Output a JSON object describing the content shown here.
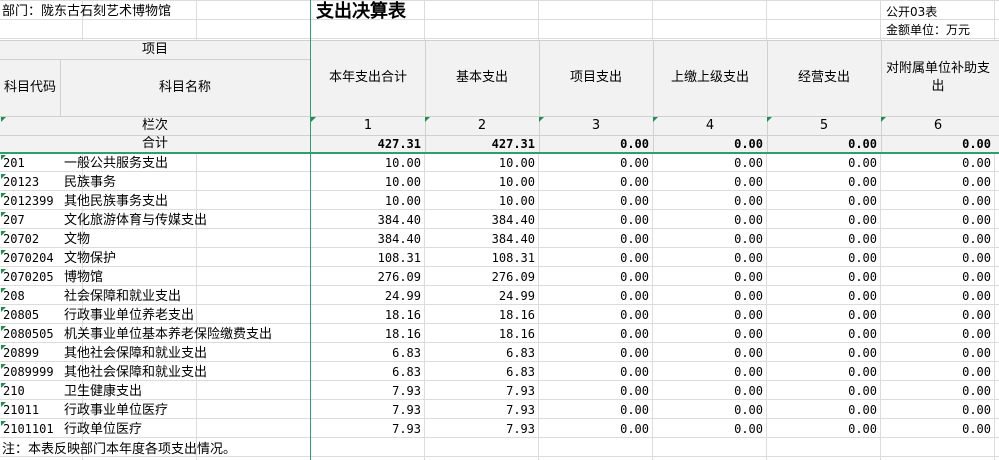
{
  "sheet": {
    "department_label": "部门：陇东古石刻艺术博物馆",
    "title": "支出决算表",
    "form_code": "公开03表",
    "unit_label": "金额单位：万元",
    "note": "注：本表反映部门本年度各项支出情况。"
  },
  "header": {
    "item_label": "项目",
    "code_label": "科目代码",
    "name_label": "科目名称",
    "col_total": "本年支出合计",
    "col_basic": "基本支出",
    "col_project": "项目支出",
    "col_upper": "上缴上级支出",
    "col_business": "经营支出",
    "col_subsidy": "对附属单位补助支出",
    "seq_label": "栏次",
    "seq": [
      "1",
      "2",
      "3",
      "4",
      "5",
      "6"
    ]
  },
  "total_row": {
    "label": "合计",
    "values": [
      "427.31",
      "427.31",
      "0.00",
      "0.00",
      "0.00",
      "0.00"
    ]
  },
  "rows": [
    {
      "code": "201",
      "name": "一般公共服务支出",
      "values": [
        "10.00",
        "10.00",
        "0.00",
        "0.00",
        "0.00",
        "0.00"
      ]
    },
    {
      "code": "20123",
      "name": "民族事务",
      "values": [
        "10.00",
        "10.00",
        "0.00",
        "0.00",
        "0.00",
        "0.00"
      ]
    },
    {
      "code": "2012399",
      "name": "其他民族事务支出",
      "values": [
        "10.00",
        "10.00",
        "0.00",
        "0.00",
        "0.00",
        "0.00"
      ]
    },
    {
      "code": "207",
      "name": "文化旅游体育与传媒支出",
      "values": [
        "384.40",
        "384.40",
        "0.00",
        "0.00",
        "0.00",
        "0.00"
      ]
    },
    {
      "code": "20702",
      "name": "文物",
      "values": [
        "384.40",
        "384.40",
        "0.00",
        "0.00",
        "0.00",
        "0.00"
      ]
    },
    {
      "code": "2070204",
      "name": "文物保护",
      "values": [
        "108.31",
        "108.31",
        "0.00",
        "0.00",
        "0.00",
        "0.00"
      ]
    },
    {
      "code": "2070205",
      "name": "博物馆",
      "values": [
        "276.09",
        "276.09",
        "0.00",
        "0.00",
        "0.00",
        "0.00"
      ]
    },
    {
      "code": "208",
      "name": "社会保障和就业支出",
      "values": [
        "24.99",
        "24.99",
        "0.00",
        "0.00",
        "0.00",
        "0.00"
      ]
    },
    {
      "code": "20805",
      "name": "行政事业单位养老支出",
      "values": [
        "18.16",
        "18.16",
        "0.00",
        "0.00",
        "0.00",
        "0.00"
      ]
    },
    {
      "code": "2080505",
      "name": "机关事业单位基本养老保险缴费支出",
      "values": [
        "18.16",
        "18.16",
        "0.00",
        "0.00",
        "0.00",
        "0.00"
      ]
    },
    {
      "code": "20899",
      "name": "其他社会保障和就业支出",
      "values": [
        "6.83",
        "6.83",
        "0.00",
        "0.00",
        "0.00",
        "0.00"
      ]
    },
    {
      "code": "2089999",
      "name": "其他社会保障和就业支出",
      "values": [
        "6.83",
        "6.83",
        "0.00",
        "0.00",
        "0.00",
        "0.00"
      ]
    },
    {
      "code": "210",
      "name": "卫生健康支出",
      "values": [
        "7.93",
        "7.93",
        "0.00",
        "0.00",
        "0.00",
        "0.00"
      ]
    },
    {
      "code": "21011",
      "name": "行政事业单位医疗",
      "values": [
        "7.93",
        "7.93",
        "0.00",
        "0.00",
        "0.00",
        "0.00"
      ]
    },
    {
      "code": "2101101",
      "name": "行政单位医疗",
      "values": [
        "7.93",
        "7.93",
        "0.00",
        "0.00",
        "0.00",
        "0.00"
      ]
    }
  ]
}
